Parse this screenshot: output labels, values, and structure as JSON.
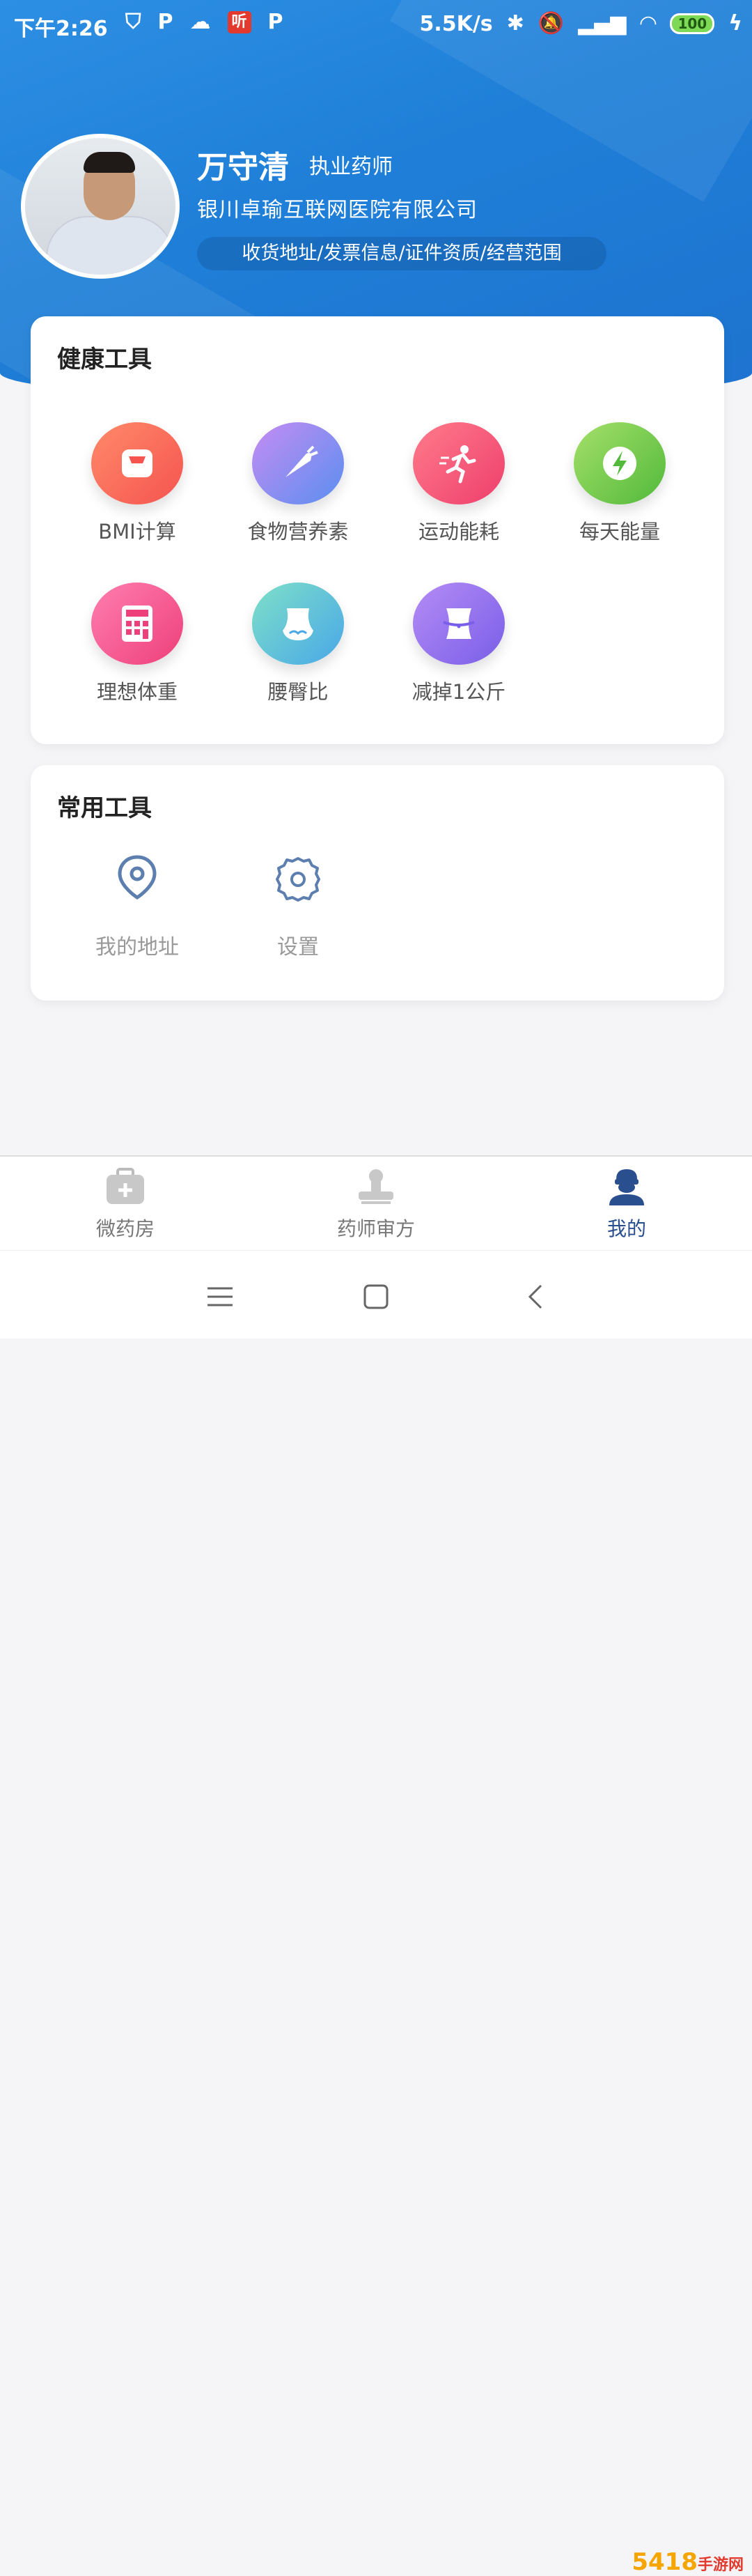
{
  "status_bar": {
    "time": "下午2:26",
    "network_speed": "5.5K/s",
    "battery": "100",
    "ting_label": "听"
  },
  "profile": {
    "name": "万守清",
    "role": "执业药师",
    "company": "银川卓瑜互联网医院有限公司",
    "links": "收货地址/发票信息/证件资质/经营范围"
  },
  "health_tools": {
    "title": "健康工具",
    "items": [
      {
        "label": "BMI计算",
        "icon": "scale-icon",
        "color": "#ff6b5e"
      },
      {
        "label": "食物营养素",
        "icon": "carrot-icon",
        "color": "#6d8cf5"
      },
      {
        "label": "运动能耗",
        "icon": "runner-icon",
        "color": "#f2547a"
      },
      {
        "label": "每天能量",
        "icon": "lightning-icon",
        "color": "#7ccf4a"
      },
      {
        "label": "理想体重",
        "icon": "calculator-icon",
        "color": "#f45b93"
      },
      {
        "label": "腰臀比",
        "icon": "hip-icon",
        "color": "#59c6c2"
      },
      {
        "label": "减掉1公斤",
        "icon": "waist-icon",
        "color": "#8c6cf0"
      }
    ]
  },
  "common_tools": {
    "title": "常用工具",
    "items": [
      {
        "label": "我的地址",
        "icon": "location-pin-icon"
      },
      {
        "label": "设置",
        "icon": "gear-icon"
      }
    ]
  },
  "tabs": [
    {
      "label": "微药房",
      "icon": "medicine-box-icon",
      "active": false
    },
    {
      "label": "药师审方",
      "icon": "stamp-icon",
      "active": false
    },
    {
      "label": "我的",
      "icon": "user-icon",
      "active": true
    }
  ],
  "watermark": {
    "main": "5418",
    "sub": "手游网"
  }
}
